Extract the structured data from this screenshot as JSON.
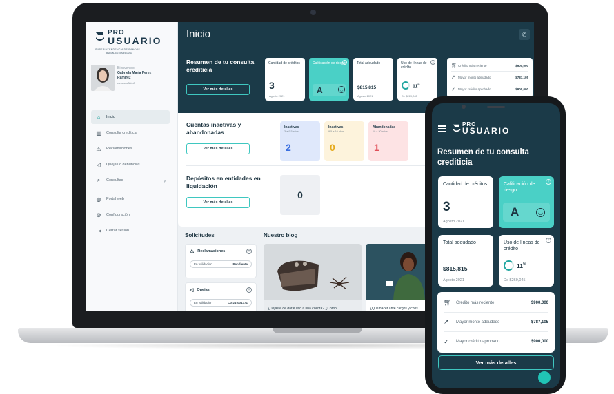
{
  "brand": {
    "pro": "PRO",
    "usuario": "USUARIO",
    "sub": "SUPERINTENDENCIA DE BANCOS",
    "sub2": "REPÚBLICA DOMINICANA"
  },
  "user": {
    "greeting": "Bienvenido",
    "name_line1": "Gabriela María Perez",
    "name_line2": "Ramírez",
    "cedula": "•••-•••••••864-8"
  },
  "sidebar": {
    "items": [
      {
        "label": "Inicio",
        "icon": "home-icon"
      },
      {
        "label": "Consulta crediticia",
        "icon": "bank-icon"
      },
      {
        "label": "Reclamaciones",
        "icon": "warning-icon"
      },
      {
        "label": "Quejas o denuncias",
        "icon": "megaphone-icon"
      },
      {
        "label": "Consultas",
        "icon": "search-icon"
      },
      {
        "label": "Portal web",
        "icon": "globe-icon"
      },
      {
        "label": "Configuración",
        "icon": "gear-icon"
      },
      {
        "label": "Cerrar sesión",
        "icon": "logout-icon"
      }
    ]
  },
  "main": {
    "title": "Inicio",
    "summary": {
      "title": "Resumen de tu consulta crediticia",
      "button": "Ver más detalles",
      "cards": {
        "credits_label": "Cantidad de créditos",
        "credits_value": "3",
        "credits_date": "Agosto 2021",
        "rating_label": "Calificación de riesgo",
        "rating_value": "A",
        "debt_label": "Total adeudado",
        "debt_value": "$815,815",
        "debt_date": "Agosto 2021",
        "lines_label": "Uso de líneas de crédito",
        "lines_value": "11",
        "lines_unit": "%",
        "lines_sub": "De $269,045"
      },
      "list": [
        {
          "label": "Crédito más reciente",
          "value": "$900,000",
          "icon": "cart-icon"
        },
        {
          "label": "Mayor monto adeudado",
          "value": "$787,105",
          "icon": "trend-icon"
        },
        {
          "label": "Mayor crédito aprobado",
          "value": "$900,000",
          "icon": "check-circle-icon"
        }
      ]
    },
    "inactive": {
      "title": "Cuentas inactivas y abandonadas",
      "button": "Ver más detalles",
      "cards": [
        {
          "title": "Inactivas",
          "sub": "3 a 9.5 años",
          "value": "2",
          "bg": "#dfe8fb",
          "color": "#3a6fe0"
        },
        {
          "title": "Inactivas",
          "sub": "9.5 a 10 años",
          "value": "0",
          "bg": "#fdf3dc",
          "color": "#e5a91a"
        },
        {
          "title": "Abandonadas",
          "sub": "10 a 20 años",
          "value": "1",
          "bg": "#fde3e4",
          "color": "#e0505a"
        }
      ]
    },
    "deposits": {
      "title": "Depósitos en entidades en liquidación",
      "button": "Ver más detalles",
      "value": "0"
    },
    "requests": {
      "title": "Solicitudes",
      "items": [
        {
          "label": "Reclamaciones",
          "status": "En validación",
          "ref": "Pendiente"
        },
        {
          "label": "Quejas",
          "status": "En validación",
          "ref": "C0-21-001371"
        }
      ]
    },
    "blog": {
      "title": "Nuestro blog",
      "posts": [
        {
          "caption": "¿Dejaste de darle uso a una cuenta? ¿Cómo"
        },
        {
          "caption": "¿Qué hacer ante cargos y cons"
        }
      ]
    }
  },
  "mobile": {
    "title": "Resumen de tu consulta crediticia",
    "credits_label": "Cantidad de créditos",
    "credits_value": "3",
    "credits_date": "Agosto 2021",
    "rating_label": "Calificación de riesgo",
    "rating_value": "A",
    "debt_label": "Total adeudado",
    "debt_value": "$815,815",
    "debt_date": "Agosto 2021",
    "lines_label": "Uso de líneas de crédito",
    "lines_value": "11",
    "lines_unit": "%",
    "lines_sub": "De $269,045",
    "list": [
      {
        "label": "Crédito más reciente",
        "value": "$900,000"
      },
      {
        "label": "Mayor monto adeudado",
        "value": "$787,105"
      },
      {
        "label": "Mayor crédito aprobado",
        "value": "$900,000"
      }
    ],
    "button": "Ver más detalles"
  },
  "colors": {
    "navy": "#1b3a48",
    "teal": "#4ad0c6",
    "accent": "#3fc7c0"
  }
}
